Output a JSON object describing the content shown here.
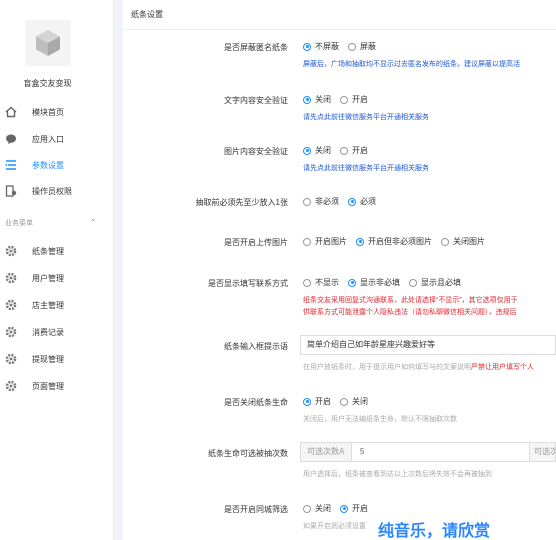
{
  "sidebar": {
    "app_name": "盲盒交友变现",
    "items": [
      {
        "label": "模块首页",
        "icon": "home-icon"
      },
      {
        "label": "应用入口",
        "icon": "chat-bubble-icon"
      },
      {
        "label": "参数设置",
        "icon": "list-settings-icon",
        "active": true
      },
      {
        "label": "操作员权限",
        "icon": "user-shield-icon"
      }
    ],
    "group_title": "业务菜单",
    "group_items": [
      {
        "label": "纸条管理",
        "icon": "gear-icon"
      },
      {
        "label": "用户管理",
        "icon": "gear-icon"
      },
      {
        "label": "店主管理",
        "icon": "gear-icon"
      },
      {
        "label": "消费记录",
        "icon": "gear-icon"
      },
      {
        "label": "提现管理",
        "icon": "gear-icon"
      },
      {
        "label": "页面管理",
        "icon": "gear-icon"
      }
    ]
  },
  "main": {
    "section_title": "纸条设置",
    "rows": {
      "shield_anon": {
        "label": "是否屏蔽匿名纸条",
        "opt1": "不屏蔽",
        "opt2": "屏蔽",
        "hint": "屏蔽后，广场和抽取均不显示过去匿名发布的纸条。建议屏蔽以提高活"
      },
      "text_check": {
        "label": "文字内容安全验证",
        "opt1": "关闭",
        "opt2": "开启",
        "hint": "请先点此前往微信服务平台开通相关服务"
      },
      "img_check": {
        "label": "图片内容安全验证",
        "opt1": "关闭",
        "opt2": "开启",
        "hint": "请先点此前往微信服务平台开通相关服务"
      },
      "must_put": {
        "label": "抽取前必须先至少放入1张",
        "opt1": "非必须",
        "opt2": "必须"
      },
      "upload_img": {
        "label": "是否开启上传图片",
        "opt1": "开启图片",
        "opt2": "开启但非必须图片",
        "opt3": "关闭图片"
      },
      "contact": {
        "label": "是否显示填写联系方式",
        "opt1": "不显示",
        "opt2": "显示非必填",
        "opt3": "显示且必填",
        "hint1": "纸条交友采用回复式沟通联系，此处请选择“不显示”，其它选项仅用于",
        "hint2": "供联系方式可能泄露个人隐私违法（请勿私聊微信相关问题），违规后"
      },
      "input_tip": {
        "label": "纸条输入框提示语",
        "value": "简单介绍自己如年龄星座兴趣爱好等",
        "hint_gray": "在用户放纸条时，用于提示用户如何填写与的文案说明",
        "hint_red": "严禁让用户填写个人"
      },
      "lifespan": {
        "label": "是否关闭纸条生命",
        "opt1": "开启",
        "opt2": "关闭",
        "hint": "关闭后，用户无法编纸条生命，默认不限抽取次数"
      },
      "draw_times": {
        "label": "纸条生命可选被抽次数",
        "prefix": "可选次数A",
        "value": "5",
        "suffix": "可选次",
        "hint": "用户选择后，纸条被查看到达以上次数后将失效不会再被抽到"
      },
      "same_city": {
        "label": "是否开启同城筛选",
        "opt1": "关闭",
        "opt2": "开启",
        "hint": "如果开启则必须设置"
      }
    }
  },
  "watermark": "纯音乐，请欣赏",
  "colors": {
    "accent": "#1890ff",
    "link": "#1a54d6",
    "warn": "#e0262e"
  }
}
